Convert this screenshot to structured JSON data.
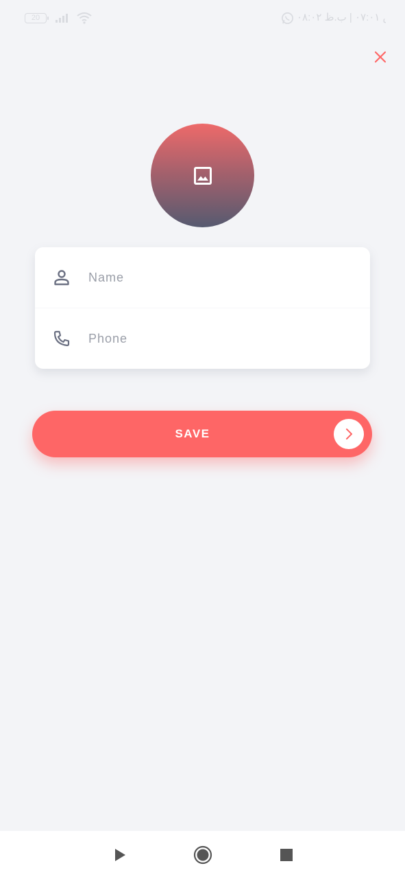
{
  "status_bar": {
    "battery_level": "20",
    "time_text": "ص ٠٧:٠١ | ب.ظ ٠٨:٠٢"
  },
  "icons": {
    "close": "close-icon",
    "avatar": "image-icon",
    "name": "person-icon",
    "phone": "phone-icon",
    "save_arrow": "chevron-right-icon"
  },
  "form": {
    "name_placeholder": "Name",
    "name_value": "",
    "phone_placeholder": "Phone",
    "phone_value": ""
  },
  "save_button": {
    "label": "SAVE"
  },
  "colors": {
    "accent": "#fe6666",
    "background": "#f3f4f7",
    "avatar_gradient_top": "#ee6a6a",
    "avatar_gradient_bottom": "#565a70",
    "icon": "#6b7082"
  }
}
